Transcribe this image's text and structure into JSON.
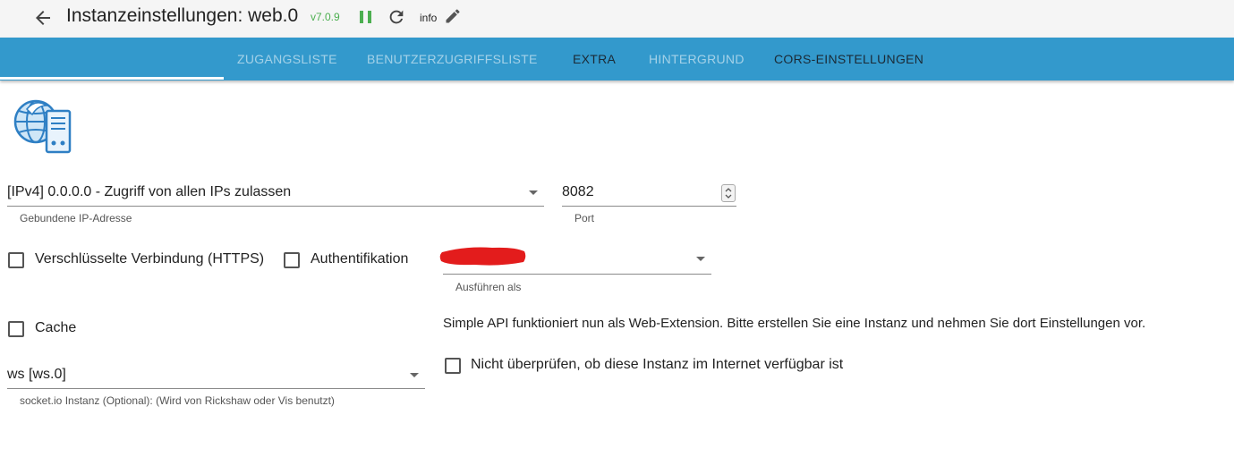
{
  "header": {
    "title": "Instanzeinstellungen: web.0",
    "version": "v7.0.9",
    "info_label": "info",
    "icons": [
      "arrow-back-icon",
      "pause-icon",
      "reload-icon",
      "edit-pencil-icon"
    ],
    "version_color": "#4caf50",
    "pause_color": "#4caf50"
  },
  "tabs": [
    {
      "label": "ZUGANGSLISTE",
      "active": false
    },
    {
      "label": "BENUTZERZUGRIFFSLISTE",
      "active": false
    },
    {
      "label": "EXTRA",
      "active": true
    },
    {
      "label": "HINTERGRUND",
      "active": false
    },
    {
      "label": "CORS-EINSTELLUNGEN",
      "active": false
    }
  ],
  "tab_bar_color": "#3399cc",
  "form": {
    "bind": {
      "value": "[IPv4] 0.0.0.0 - Zugriff von allen IPs zulassen",
      "helper": "Gebundene IP-Adresse"
    },
    "port": {
      "value": "8082",
      "helper": "Port"
    },
    "https": {
      "label": "Verschlüsselte Verbindung (HTTPS)",
      "checked": false
    },
    "auth": {
      "label": "Authentifikation",
      "checked": false
    },
    "run_as": {
      "helper": "Ausführen als",
      "value_redacted": true
    },
    "cache": {
      "label": "Cache",
      "checked": false
    },
    "socketio": {
      "value": "ws [ws.0]",
      "helper": "socket.io Instanz (Optional): (Wird von Rickshaw oder Vis benutzt)"
    },
    "simple_api_note": "Simple API funktioniert nun als Web-Extension. Bitte erstellen Sie eine Instanz und nehmen Sie dort Einstellungen vor.",
    "no_check": {
      "label": "Nicht überprüfen, ob diese Instanz im Internet verfügbar ist",
      "checked": false
    }
  },
  "redaction_color": "#e31c1c"
}
